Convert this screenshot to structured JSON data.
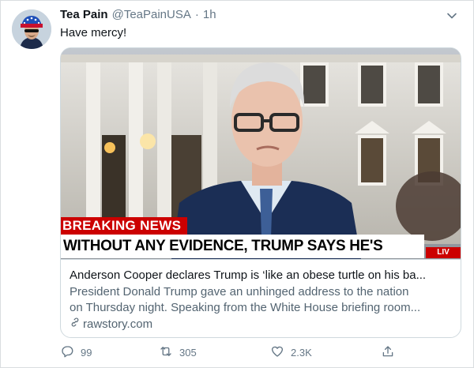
{
  "tweet": {
    "author_name": "Tea Pain",
    "author_handle": "@TeaPainUSA",
    "separator": "·",
    "time": "1h",
    "text": "Have mercy!"
  },
  "card": {
    "breaking_label": "BREAKING NEWS",
    "chyron": "WITHOUT ANY EVIDENCE, TRUMP SAYS HE'S BEING CHEATED",
    "live_label": "LIV",
    "title": "Anderson Cooper declares Trump is ‘like an obese turtle on his ba...",
    "description_line1": "President Donald Trump gave an unhinged address to the nation",
    "description_line2": "on Thursday night. Speaking from the White House briefing room...",
    "domain": "rawstory.com"
  },
  "actions": {
    "replies": "99",
    "retweets": "305",
    "likes": "2.3K"
  },
  "icons": {
    "menu": "chevron-down-icon",
    "reply": "reply-icon",
    "retweet": "retweet-icon",
    "like": "heart-icon",
    "share": "share-icon",
    "link": "link-icon"
  },
  "colors": {
    "breaking_red": "#cc0000",
    "secondary_text": "#657786"
  }
}
